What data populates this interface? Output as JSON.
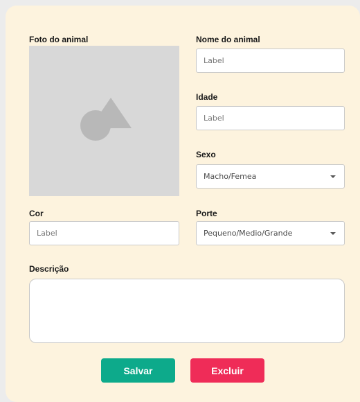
{
  "form": {
    "photo_label": "Foto do animal",
    "name_label": "Nome do animal",
    "name_placeholder": "Label",
    "age_label": "Idade",
    "age_placeholder": "Label",
    "sex_label": "Sexo",
    "sex_value": "Macho/Femea",
    "color_label": "Cor",
    "color_placeholder": "Label",
    "size_label": "Porte",
    "size_value": "Pequeno/Medio/Grande",
    "description_label": "Descrição"
  },
  "actions": {
    "save_label": "Salvar",
    "delete_label": "Excluir"
  },
  "colors": {
    "background": "#fdf3de",
    "save": "#0daa8b",
    "delete": "#ef2c58"
  },
  "icons": {
    "photo": "image-placeholder-icon",
    "dropdown": "chevron-down-icon"
  }
}
